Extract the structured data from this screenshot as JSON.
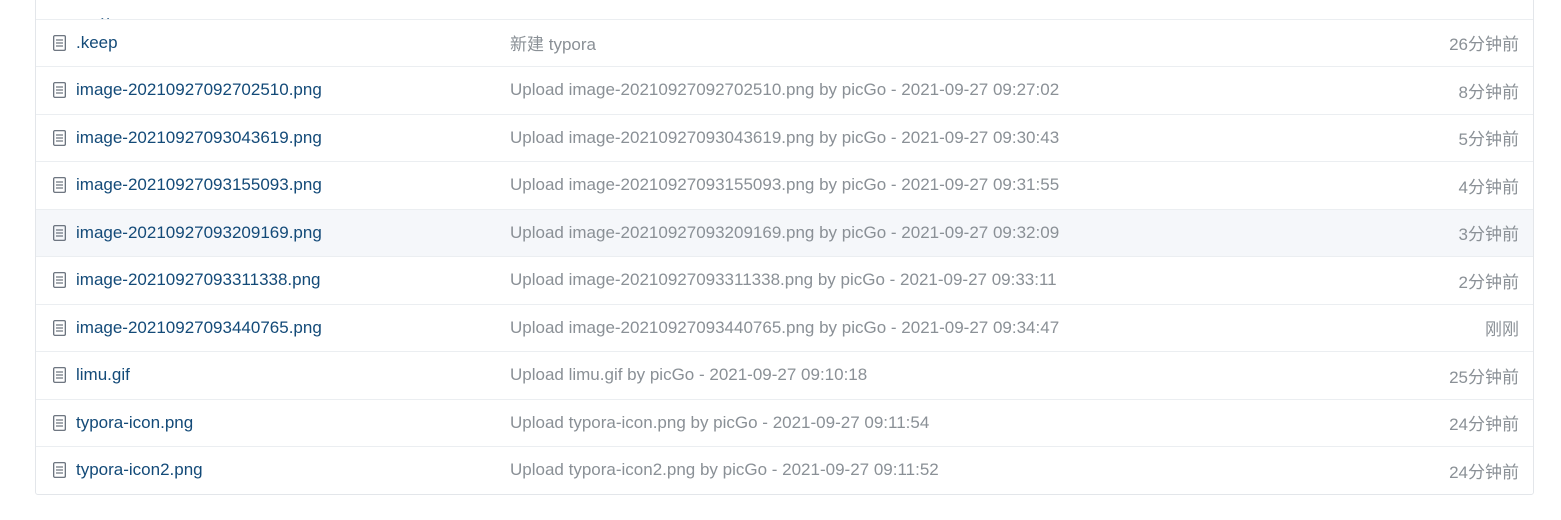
{
  "files": [
    {
      "icon": "file-icon",
      "name": ".keep",
      "message": "新建 typora",
      "time": "26分钟前"
    },
    {
      "icon": "file-icon",
      "name": "image-20210927092702510.png",
      "message": "Upload image-20210927092702510.png by picGo - 2021-09-27 09:27:02",
      "time": "8分钟前"
    },
    {
      "icon": "file-icon",
      "name": "image-20210927093043619.png",
      "message": "Upload image-20210927093043619.png by picGo - 2021-09-27 09:30:43",
      "time": "5分钟前"
    },
    {
      "icon": "file-icon",
      "name": "image-20210927093155093.png",
      "message": "Upload image-20210927093155093.png by picGo - 2021-09-27 09:31:55",
      "time": "4分钟前"
    },
    {
      "icon": "file-icon",
      "name": "image-20210927093209169.png",
      "message": "Upload image-20210927093209169.png by picGo - 2021-09-27 09:32:09",
      "time": "3分钟前"
    },
    {
      "icon": "file-icon",
      "name": "image-20210927093311338.png",
      "message": "Upload image-20210927093311338.png by picGo - 2021-09-27 09:33:11",
      "time": "2分钟前"
    },
    {
      "icon": "file-icon",
      "name": "image-20210927093440765.png",
      "message": "Upload image-20210927093440765.png by picGo - 2021-09-27 09:34:47",
      "time": "刚刚"
    },
    {
      "icon": "file-icon",
      "name": "limu.gif",
      "message": "Upload limu.gif by picGo - 2021-09-27 09:10:18",
      "time": "25分钟前"
    },
    {
      "icon": "file-icon",
      "name": "typora-icon.png",
      "message": "Upload typora-icon.png by picGo - 2021-09-27 09:11:54",
      "time": "24分钟前"
    },
    {
      "icon": "file-icon",
      "name": "typora-icon2.png",
      "message": "Upload typora-icon2.png by picGo - 2021-09-27 09:11:52",
      "time": "24分钟前"
    }
  ],
  "parent_row": {
    "label": ".."
  },
  "colors": {
    "link": "#134a78",
    "muted": "#8a9096",
    "border": "#ebeef1",
    "hover_row": "#f5f7fa"
  }
}
